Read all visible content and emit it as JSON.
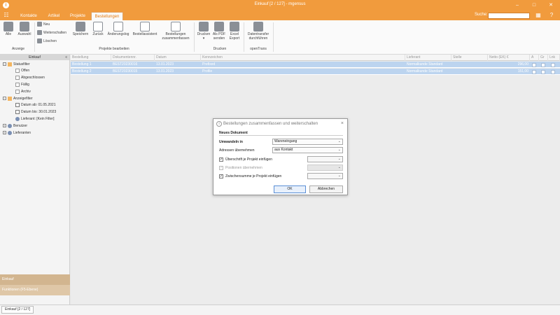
{
  "window": {
    "title": "Einkauf [2 / 127] - mgensus",
    "logo": "i",
    "minimize": "–",
    "maximize": "□",
    "close": "✕"
  },
  "tabs": [
    {
      "label": "Kontakte"
    },
    {
      "label": "Artikel"
    },
    {
      "label": "Projekte"
    },
    {
      "label": "Bestellungen"
    }
  ],
  "search": {
    "label": "Suche:",
    "value": ""
  },
  "ribbon": {
    "anzeige": {
      "alle": "Alle",
      "auswahl": "Auswahl",
      "group": "Anzeige"
    },
    "bearbeiten": {
      "neu": "Neu",
      "weiterschalten": "Weiterschalten",
      "loeschen": "Löschen",
      "speichern": "Speichern",
      "zurueck": "Zurück",
      "aenderungslog": "Änderungslog",
      "bestellassistent": "Bestellassistent",
      "zusammenfassen_1": "Bestellungen",
      "zusammenfassen_2": "zusammenfassen",
      "group": "Projekte bearbeiten"
    },
    "drucken": {
      "drucken_1": "Drucken",
      "drucken_2": "▾",
      "pdf_1": "Als PDF",
      "pdf_2": "senden",
      "excel_1": "Excel",
      "excel_2": "Export",
      "group": "Drucken"
    },
    "opentrans": {
      "transfer_1": "Datentransfer",
      "transfer_2": "durchführen",
      "group": "openTrans"
    }
  },
  "sidebar": {
    "header": "Einkauf",
    "collapse": "«",
    "statusfilter": "Statusfilter",
    "items": [
      "Offen",
      "Abgeschlossen",
      "Fällig",
      "Archiv"
    ],
    "anzeigefilter": "Anzeigefilter",
    "filters": [
      "Datum ab: 01.05.2021",
      "Datum bis: 30.01.2023",
      "Lieferant: [Kein Filter]"
    ],
    "benutzer": "Benutzer",
    "lieferanten": "Lieferanten",
    "bottom1": "Einkauf",
    "bottom2": "Funktionen (F5-Ebene)"
  },
  "grid": {
    "columns": [
      "Bestellung",
      "Dokumentennr.",
      "Datum",
      "Kennzeichen",
      "Lieferant",
      "Stelle",
      "Netto (EK) €",
      "A",
      "Gr",
      "Lnk"
    ],
    "rows": [
      {
        "bestellung": "Bestellung 1",
        "nr": "BEST20230016",
        "datum": "13.01.2023",
        "kennzeichen": "Prefixed",
        "lieferant": "Normalkunde Standard",
        "stelle": "",
        "netto": "296,00"
      },
      {
        "bestellung": "Bestellung 2",
        "nr": "BEST20230015",
        "datum": "13.01.2023",
        "kennzeichen": "Profile",
        "lieferant": "Normalkunde Standard",
        "stelle": "",
        "netto": "151,00"
      }
    ]
  },
  "dialog": {
    "title": "Bestellungen zusammenfassen und weiterschalten",
    "section": "Neues Dokument",
    "umwandeln_label": "Umwandeln in",
    "umwandeln_value": "Wareneingang",
    "adressen_label": "Adressen übernehmen",
    "adressen_value": "aus Kontakt",
    "check1_label": "Überschrift je Projekt einfügen",
    "check2_label": "Positionen übernehmen",
    "check3_label": "Zwischensumme je Projekt einfügen",
    "check_mark": "✓",
    "arrow": "⌄",
    "ok": "OK",
    "cancel": "Abbrechen"
  },
  "statusbar": {
    "tab": "Einkauf [2 / 127]"
  }
}
